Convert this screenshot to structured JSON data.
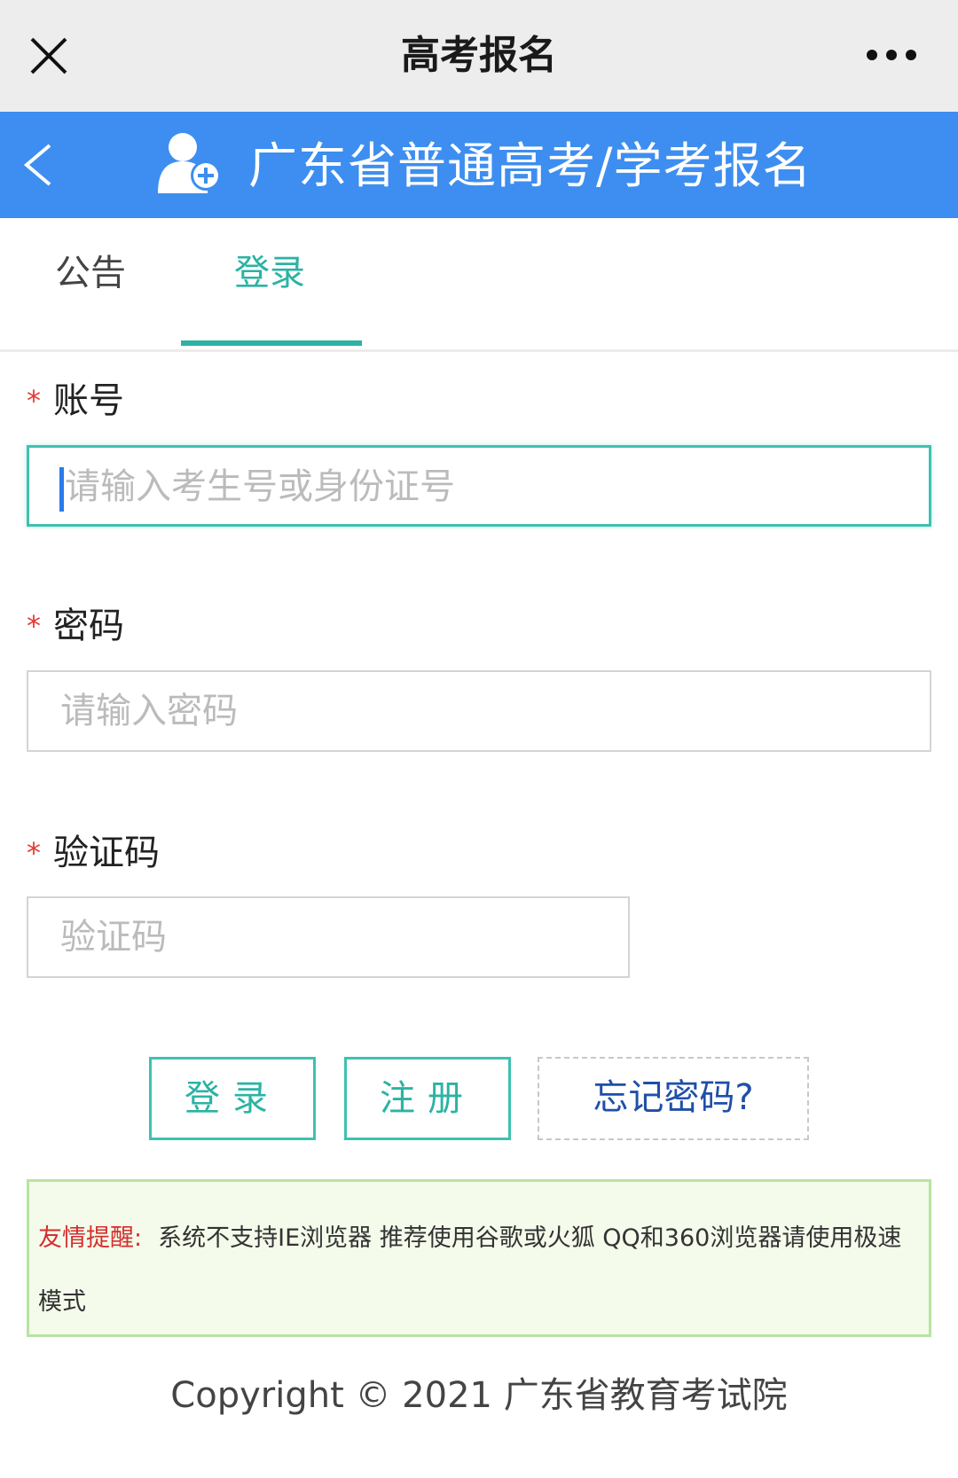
{
  "window": {
    "title": "高考报名",
    "close_icon": "close-icon",
    "more_icon": "more-dots-icon"
  },
  "header": {
    "title": "广东省普通高考/学考报名",
    "back_icon": "back-chevron-icon",
    "logo_icon": "user-add-icon",
    "color": "#3d8ef0"
  },
  "tabs": [
    {
      "label": "公告",
      "active": false
    },
    {
      "label": "登录",
      "active": true
    }
  ],
  "form": {
    "required_mark": "*",
    "account": {
      "label": "账号",
      "placeholder": "请输入考生号或身份证号",
      "value": ""
    },
    "password": {
      "label": "密码",
      "placeholder": "请输入密码",
      "value": ""
    },
    "captcha": {
      "label": "验证码",
      "placeholder": "验证码",
      "value": ""
    }
  },
  "buttons": {
    "login": "登录",
    "register": "注册",
    "forgot": "忘记密码?"
  },
  "notice": {
    "label": "友情提醒:",
    "text": "系统不支持IE浏览器 推荐使用谷歌或火狐 QQ和360浏览器请使用极速模式"
  },
  "footer": {
    "copyright": "Copyright © 2021 广东省教育考试院"
  },
  "colors": {
    "accent": "#2bb3a4",
    "required": "#e53935",
    "link": "#1f4fa8"
  }
}
